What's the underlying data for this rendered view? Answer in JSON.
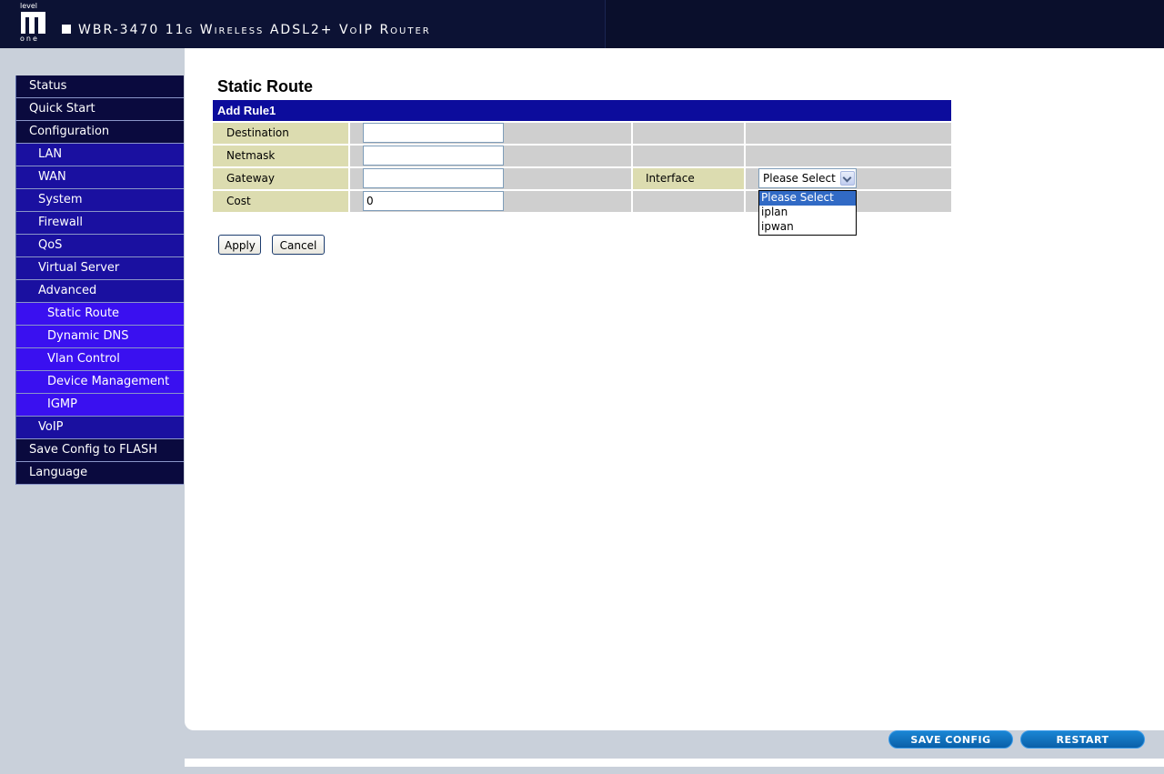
{
  "header": {
    "logo": {
      "top": "level",
      "bottom": "one"
    },
    "product_title": "WBR-3470 11g Wireless ADSL2+ VoIP Router"
  },
  "sidebar": {
    "items": [
      {
        "label": "Status",
        "level": 0
      },
      {
        "label": "Quick Start",
        "level": 0
      },
      {
        "label": "Configuration",
        "level": 0
      },
      {
        "label": "LAN",
        "level": 1
      },
      {
        "label": "WAN",
        "level": 1
      },
      {
        "label": "System",
        "level": 1
      },
      {
        "label": "Firewall",
        "level": 1
      },
      {
        "label": "QoS",
        "level": 1
      },
      {
        "label": "Virtual Server",
        "level": 1
      },
      {
        "label": "Advanced",
        "level": 1
      },
      {
        "label": "Static Route",
        "level": 2
      },
      {
        "label": "Dynamic DNS",
        "level": 2
      },
      {
        "label": "Vlan Control",
        "level": 2
      },
      {
        "label": "Device Management",
        "level": 2
      },
      {
        "label": "IGMP",
        "level": 2
      },
      {
        "label": "VoIP",
        "level": 1
      },
      {
        "label": "Save Config to FLASH",
        "level": 0
      },
      {
        "label": "Language",
        "level": 0
      }
    ]
  },
  "main": {
    "title": "Static Route",
    "rule_header": "Add Rule1",
    "fields": {
      "destination": {
        "label": "Destination",
        "value": ""
      },
      "netmask": {
        "label": "Netmask",
        "value": ""
      },
      "gateway": {
        "label": "Gateway",
        "value": ""
      },
      "cost": {
        "label": "Cost",
        "value": "0"
      }
    },
    "interface": {
      "label": "Interface",
      "selected": "Please Select",
      "options": [
        "Please Select",
        "iplan",
        "ipwan"
      ]
    },
    "buttons": {
      "apply": "Apply",
      "cancel": "Cancel"
    }
  },
  "footer": {
    "save_config": "SAVE CONFIG",
    "restart": "RESTART"
  },
  "colors": {
    "header_bg": "#0c1234",
    "nav_level0": "#0a0a3e",
    "nav_level1": "#1a10a0",
    "nav_level2": "#3a10f0",
    "rule_header_bg": "#0c0c9c",
    "label_bg": "#dcdcb0",
    "cell_bg": "#cfcfcf",
    "pill_blue": "#0a6fc0"
  }
}
